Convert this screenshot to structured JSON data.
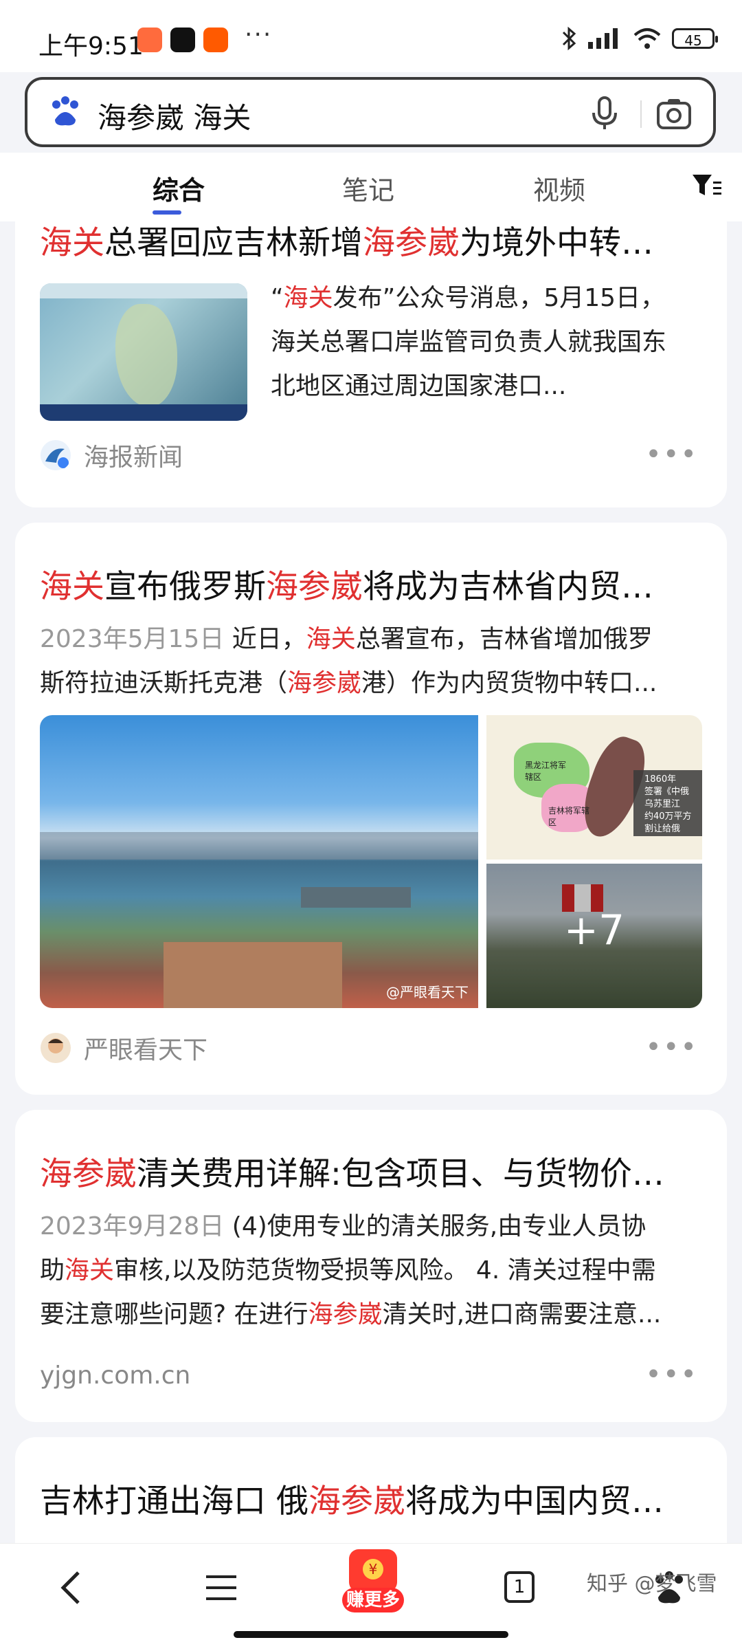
{
  "status": {
    "time": "上午9:51",
    "more": "···",
    "battery": "45"
  },
  "search": {
    "query": "海参崴 海关"
  },
  "tabs": [
    {
      "label": "综合",
      "active": true
    },
    {
      "label": "笔记",
      "active": false
    },
    {
      "label": "视频",
      "active": false
    }
  ],
  "results": [
    {
      "title_parts": [
        "海关",
        "总署回应吉林新增",
        "海参崴",
        "为境外中转…"
      ],
      "snippet_lines": [
        "“海关发布”公众号消息，5月15日，",
        "海关总署口岸监管司负责人就我国东",
        "北地区通过周边国家港口..."
      ],
      "source": "海报新闻"
    },
    {
      "title_parts": [
        "海关",
        "宣布俄罗斯",
        "海参崴",
        "将成为吉林省内贸…"
      ],
      "date": "2023年5月15日",
      "snippet_line1": "近日，海关总署宣布，吉林省增加俄罗",
      "snippet_line2": "斯符拉迪沃斯托克港（海参崴港）作为内贸货物中转口...",
      "image_main_caption": "@严眼看天下",
      "image_map_text": [
        "黑龙江将军辖区",
        "吉林将军辖区",
        "1860年",
        "签署《中俄",
        "乌苏里江",
        "约40万平方",
        "割让给俄"
      ],
      "more_count": "+7",
      "source": "严眼看天下"
    },
    {
      "title_parts": [
        "海参崴",
        "清关费用详解:包含项目、与货物价…"
      ],
      "date": "2023年9月28日",
      "snippet_line1": "(4)使用专业的清关服务,由专业人员协",
      "snippet_line2": "助海关审核,以及防范货物受损等风险。 4. 清关过程中需",
      "snippet_line3": "要注意哪些问题? 在进行海参崴清关时,进口商需要注意...",
      "source": "yjgn.com.cn"
    },
    {
      "title_parts": [
        "吉林打通出海口 俄",
        "海参崴",
        "将成为中国内贸…"
      ]
    }
  ],
  "bottom_nav": {
    "earn_label": "赚更多",
    "tab_count": "1"
  },
  "watermark": "知乎 @梦飞雪",
  "colors": {
    "highlight": "#e03030",
    "accent": "#3b5bdb",
    "background": "#f3f4f8"
  }
}
